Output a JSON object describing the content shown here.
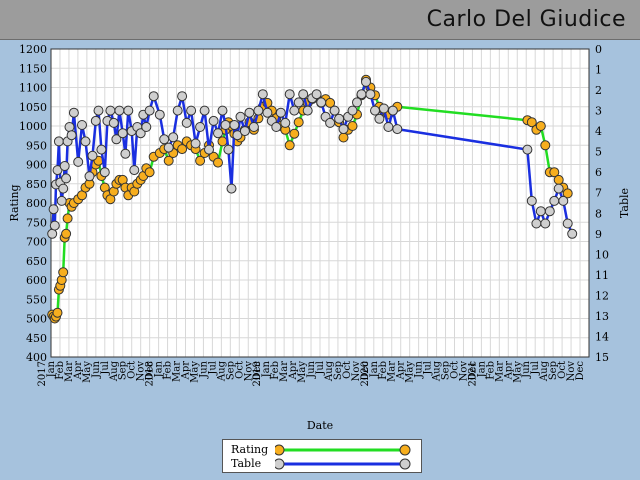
{
  "header": {
    "name": "Carlo Del Giudice"
  },
  "colors": {
    "rating_line": "#22dd22",
    "table_line": "#1a2fe0",
    "rating_marker": "#f7ae1e",
    "table_marker": "#cfcfcf",
    "background": "#a6c2dd",
    "header": "#9c9c9c"
  },
  "legend": {
    "rating_label": "Rating",
    "table_label": "Table"
  },
  "chart_data": {
    "type": "line",
    "xlabel": "Date",
    "ylabel_left": "Rating",
    "ylabel_right": "Table",
    "y_left_range": [
      400,
      1200
    ],
    "y_left_ticks": [
      400,
      450,
      500,
      550,
      600,
      650,
      700,
      750,
      800,
      850,
      900,
      950,
      1000,
      1050,
      1100,
      1150,
      1200
    ],
    "y_right_range": [
      0,
      15
    ],
    "y_right_ticks": [
      0,
      1,
      2,
      3,
      4,
      5,
      6,
      7,
      8,
      9,
      10,
      11,
      12,
      13,
      14,
      15
    ],
    "right_axis_inverted": true,
    "x_range": [
      "2017-01",
      "2022-01"
    ],
    "x_tick_labels": [
      "Jan",
      "Feb",
      "Mar",
      "Apr",
      "May",
      "Jun",
      "Jul",
      "Aug",
      "Sep",
      "Oct",
      "Nov",
      "Dec"
    ],
    "year_labels": [
      "2017",
      "2018",
      "2019",
      "2020",
      "2021"
    ],
    "grid": true,
    "legend_position": "bottom-center",
    "series": [
      {
        "name": "Rating",
        "axis": "left",
        "points": [
          [
            "2017-01-05",
            510
          ],
          [
            "2017-01-10",
            505
          ],
          [
            "2017-01-14",
            500
          ],
          [
            "2017-01-18",
            505
          ],
          [
            "2017-01-23",
            515
          ],
          [
            "2017-01-28",
            575
          ],
          [
            "2017-02-02",
            585
          ],
          [
            "2017-02-07",
            600
          ],
          [
            "2017-02-12",
            620
          ],
          [
            "2017-02-17",
            710
          ],
          [
            "2017-02-22",
            720
          ],
          [
            "2017-02-27",
            760
          ],
          [
            "2017-03-03",
            800
          ],
          [
            "2017-03-10",
            790
          ],
          [
            "2017-03-18",
            800
          ],
          [
            "2017-04-02",
            810
          ],
          [
            "2017-04-15",
            820
          ],
          [
            "2017-04-27",
            840
          ],
          [
            "2017-05-10",
            850
          ],
          [
            "2017-05-20",
            880
          ],
          [
            "2017-06-01",
            900
          ],
          [
            "2017-06-10",
            910
          ],
          [
            "2017-06-20",
            870
          ],
          [
            "2017-07-01",
            840
          ],
          [
            "2017-07-10",
            820
          ],
          [
            "2017-07-20",
            810
          ],
          [
            "2017-08-01",
            830
          ],
          [
            "2017-08-10",
            850
          ],
          [
            "2017-08-20",
            860
          ],
          [
            "2017-09-01",
            860
          ],
          [
            "2017-09-10",
            840
          ],
          [
            "2017-09-20",
            820
          ],
          [
            "2017-10-01",
            840
          ],
          [
            "2017-10-10",
            830
          ],
          [
            "2017-10-20",
            850
          ],
          [
            "2017-11-01",
            860
          ],
          [
            "2017-11-10",
            870
          ],
          [
            "2017-11-20",
            890
          ],
          [
            "2017-12-01",
            880
          ],
          [
            "2017-12-15",
            920
          ],
          [
            "2018-01-05",
            930
          ],
          [
            "2018-01-20",
            940
          ],
          [
            "2018-02-05",
            910
          ],
          [
            "2018-02-20",
            930
          ],
          [
            "2018-03-05",
            950
          ],
          [
            "2018-03-20",
            940
          ],
          [
            "2018-04-05",
            960
          ],
          [
            "2018-04-20",
            950
          ],
          [
            "2018-05-05",
            940
          ],
          [
            "2018-05-20",
            910
          ],
          [
            "2018-06-05",
            930
          ],
          [
            "2018-06-20",
            950
          ],
          [
            "2018-07-05",
            920
          ],
          [
            "2018-07-20",
            905
          ],
          [
            "2018-08-05",
            960
          ],
          [
            "2018-08-15",
            990
          ],
          [
            "2018-08-25",
            1010
          ],
          [
            "2018-09-05",
            1000
          ],
          [
            "2018-09-15",
            980
          ],
          [
            "2018-09-25",
            960
          ],
          [
            "2018-10-05",
            970
          ],
          [
            "2018-10-20",
            990
          ],
          [
            "2018-11-05",
            1010
          ],
          [
            "2018-11-20",
            990
          ],
          [
            "2018-12-05",
            1020
          ],
          [
            "2018-12-20",
            1050
          ],
          [
            "2019-01-05",
            1060
          ],
          [
            "2019-01-20",
            1040
          ],
          [
            "2019-02-05",
            1020
          ],
          [
            "2019-02-20",
            1000
          ],
          [
            "2019-03-05",
            990
          ],
          [
            "2019-03-20",
            950
          ],
          [
            "2019-04-05",
            980
          ],
          [
            "2019-04-20",
            1010
          ],
          [
            "2019-05-05",
            1040
          ],
          [
            "2019-05-20",
            1060
          ],
          [
            "2019-06-05",
            1070
          ],
          [
            "2019-06-20",
            1080
          ],
          [
            "2019-07-05",
            1060
          ],
          [
            "2019-07-20",
            1070
          ],
          [
            "2019-08-05",
            1060
          ],
          [
            "2019-08-20",
            1040
          ],
          [
            "2019-09-05",
            1010
          ],
          [
            "2019-09-20",
            970
          ],
          [
            "2019-10-05",
            990
          ],
          [
            "2019-10-20",
            1000
          ],
          [
            "2019-11-05",
            1030
          ],
          [
            "2019-11-20",
            1080
          ],
          [
            "2019-12-05",
            1120
          ],
          [
            "2019-12-20",
            1100
          ],
          [
            "2020-01-05",
            1080
          ],
          [
            "2020-01-20",
            1050
          ],
          [
            "2020-02-05",
            1040
          ],
          [
            "2020-02-20",
            1030
          ],
          [
            "2020-03-05",
            1040
          ],
          [
            "2020-03-20",
            1050
          ],
          [
            "2021-06-05",
            1015
          ],
          [
            "2021-06-20",
            1010
          ],
          [
            "2021-07-05",
            990
          ],
          [
            "2021-07-20",
            1000
          ],
          [
            "2021-08-05",
            950
          ],
          [
            "2021-08-20",
            880
          ],
          [
            "2021-09-05",
            880
          ],
          [
            "2021-09-20",
            860
          ],
          [
            "2021-10-05",
            840
          ],
          [
            "2021-10-20",
            825
          ]
        ]
      },
      {
        "name": "Table",
        "axis": "right",
        "points": [
          [
            "2017-01-05",
            9
          ],
          [
            "2017-01-10",
            7.8
          ],
          [
            "2017-01-14",
            8.6
          ],
          [
            "2017-01-18",
            6.6
          ],
          [
            "2017-01-23",
            5.9
          ],
          [
            "2017-01-28",
            4.5
          ],
          [
            "2017-02-02",
            6.5
          ],
          [
            "2017-02-07",
            7.4
          ],
          [
            "2017-02-12",
            6.8
          ],
          [
            "2017-02-17",
            5.7
          ],
          [
            "2017-02-22",
            6.3
          ],
          [
            "2017-02-27",
            4.5
          ],
          [
            "2017-03-03",
            3.8
          ],
          [
            "2017-03-10",
            4.2
          ],
          [
            "2017-03-18",
            3.1
          ],
          [
            "2017-04-02",
            5.5
          ],
          [
            "2017-04-15",
            3.7
          ],
          [
            "2017-04-27",
            4.5
          ],
          [
            "2017-05-10",
            6.2
          ],
          [
            "2017-05-20",
            5.2
          ],
          [
            "2017-06-01",
            3.5
          ],
          [
            "2017-06-10",
            3.0
          ],
          [
            "2017-06-20",
            4.9
          ],
          [
            "2017-07-01",
            6.0
          ],
          [
            "2017-07-10",
            3.5
          ],
          [
            "2017-07-20",
            3.0
          ],
          [
            "2017-08-01",
            3.6
          ],
          [
            "2017-08-10",
            4.4
          ],
          [
            "2017-08-20",
            3.0
          ],
          [
            "2017-09-01",
            4.1
          ],
          [
            "2017-09-10",
            5.1
          ],
          [
            "2017-09-20",
            3.0
          ],
          [
            "2017-10-01",
            4.0
          ],
          [
            "2017-10-10",
            5.9
          ],
          [
            "2017-10-20",
            3.8
          ],
          [
            "2017-11-01",
            4.1
          ],
          [
            "2017-11-10",
            3.2
          ],
          [
            "2017-11-20",
            3.8
          ],
          [
            "2017-12-01",
            3.0
          ],
          [
            "2017-12-15",
            2.3
          ],
          [
            "2018-01-05",
            3.2
          ],
          [
            "2018-01-20",
            4.4
          ],
          [
            "2018-02-05",
            4.8
          ],
          [
            "2018-02-20",
            4.3
          ],
          [
            "2018-03-05",
            3.0
          ],
          [
            "2018-03-20",
            2.3
          ],
          [
            "2018-04-05",
            3.6
          ],
          [
            "2018-04-20",
            3.0
          ],
          [
            "2018-05-05",
            4.6
          ],
          [
            "2018-05-20",
            3.8
          ],
          [
            "2018-06-05",
            3.0
          ],
          [
            "2018-06-20",
            4.9
          ],
          [
            "2018-07-05",
            3.5
          ],
          [
            "2018-07-20",
            4.1
          ],
          [
            "2018-08-05",
            3.0
          ],
          [
            "2018-08-15",
            3.7
          ],
          [
            "2018-08-25",
            4.9
          ],
          [
            "2018-09-05",
            6.8
          ],
          [
            "2018-09-15",
            3.7
          ],
          [
            "2018-09-25",
            4.2
          ],
          [
            "2018-10-05",
            3.3
          ],
          [
            "2018-10-20",
            4.0
          ],
          [
            "2018-11-05",
            3.1
          ],
          [
            "2018-11-20",
            3.8
          ],
          [
            "2018-12-05",
            3.0
          ],
          [
            "2018-12-20",
            2.2
          ],
          [
            "2019-01-05",
            3.1
          ],
          [
            "2019-01-20",
            3.5
          ],
          [
            "2019-02-05",
            3.8
          ],
          [
            "2019-02-20",
            3.1
          ],
          [
            "2019-03-05",
            3.6
          ],
          [
            "2019-03-20",
            2.2
          ],
          [
            "2019-04-05",
            3.0
          ],
          [
            "2019-04-20",
            2.6
          ],
          [
            "2019-05-05",
            2.2
          ],
          [
            "2019-05-20",
            3.0
          ],
          [
            "2019-06-05",
            2.4
          ],
          [
            "2019-06-20",
            2.2
          ],
          [
            "2019-07-05",
            2.6
          ],
          [
            "2019-07-20",
            3.3
          ],
          [
            "2019-08-05",
            3.6
          ],
          [
            "2019-08-20",
            3.0
          ],
          [
            "2019-09-05",
            3.4
          ],
          [
            "2019-09-20",
            3.9
          ],
          [
            "2019-10-05",
            3.3
          ],
          [
            "2019-10-20",
            3.0
          ],
          [
            "2019-11-05",
            2.6
          ],
          [
            "2019-11-20",
            2.2
          ],
          [
            "2019-12-05",
            1.6
          ],
          [
            "2019-12-20",
            2.2
          ],
          [
            "2020-01-05",
            3.0
          ],
          [
            "2020-01-20",
            3.4
          ],
          [
            "2020-02-05",
            2.9
          ],
          [
            "2020-02-20",
            3.8
          ],
          [
            "2020-03-05",
            3.0
          ],
          [
            "2020-03-20",
            3.9
          ],
          [
            "2021-06-05",
            4.9
          ],
          [
            "2021-06-20",
            7.4
          ],
          [
            "2021-07-05",
            8.5
          ],
          [
            "2021-07-20",
            7.9
          ],
          [
            "2021-08-05",
            8.5
          ],
          [
            "2021-08-20",
            7.9
          ],
          [
            "2021-09-05",
            7.4
          ],
          [
            "2021-09-20",
            6.8
          ],
          [
            "2021-10-05",
            7.4
          ],
          [
            "2021-10-20",
            8.5
          ],
          [
            "2021-11-05",
            9.0
          ]
        ]
      }
    ]
  }
}
